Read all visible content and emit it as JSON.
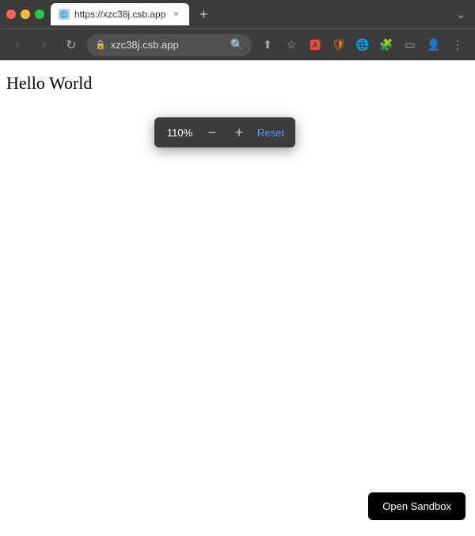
{
  "browser": {
    "url": "xzc38j.csb.app",
    "full_url": "https://xzc38j.csb.app",
    "tab_title": "https://xzc38j.csb.app",
    "tab_close_label": "×"
  },
  "nav": {
    "back_label": "‹",
    "forward_label": "›",
    "reload_label": "↻",
    "new_tab_label": "+",
    "window_controls_right": "⌄"
  },
  "zoom": {
    "value": "110%",
    "decrease_label": "−",
    "increase_label": "+",
    "reset_label": "Reset"
  },
  "content": {
    "hello_world": "Hello World"
  },
  "sandbox": {
    "button_label": "Open Sandbox"
  },
  "toolbar_icons": {
    "search": "🔍",
    "share": "⬆",
    "bookmark": "☆",
    "ext1": "🅰",
    "ext2": "🛡",
    "ext3": "🌐",
    "ext4": "🧩",
    "ext5": "▭",
    "profile": "👤",
    "menu": "⋮"
  }
}
